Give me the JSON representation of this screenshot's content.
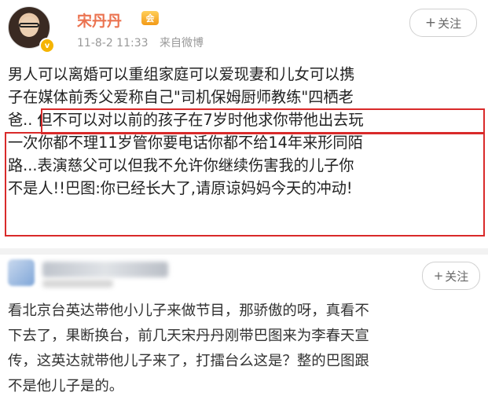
{
  "post": {
    "username": "宋丹丹",
    "member_badge": "会",
    "verified_badge": "v",
    "date": "11-8-2 11:33",
    "source": "来自微博",
    "follow_label": "关注",
    "follow_plus": "+",
    "lines": [
      "男人可以离婚可以重组家庭可以爱现妻和儿女可以携",
      "子在媒体前秀父爱称自己\"司机保姆厨师教练\"四栖老",
      "爸..",
      "但不可以对以前的孩子在7岁时他求你带他出去玩",
      "一次你都不理11岁管你要电话你都不给14年来形同陌",
      "路...表演慈父可以但我不允许你继续伤害我的儿子你",
      "不是人!!巴图:你已经长大了,请原谅妈妈今天的冲动!"
    ]
  },
  "comment": {
    "follow_label": "关注",
    "follow_plus": "+",
    "lines": [
      "看北京台英达带他小儿子来做节目，那骄傲的呀，真看不",
      "下去了，果断换台，前几天宋丹丹刚带巴图来为李春天宣",
      "传，这英达就带他儿子来了，打擂台么这是？整的巴图跟",
      "不是他儿子是的。"
    ]
  },
  "colors": {
    "username": "#eb7350",
    "highlight_border": "#d92a2a",
    "text": "#222222",
    "meta": "#999999"
  }
}
